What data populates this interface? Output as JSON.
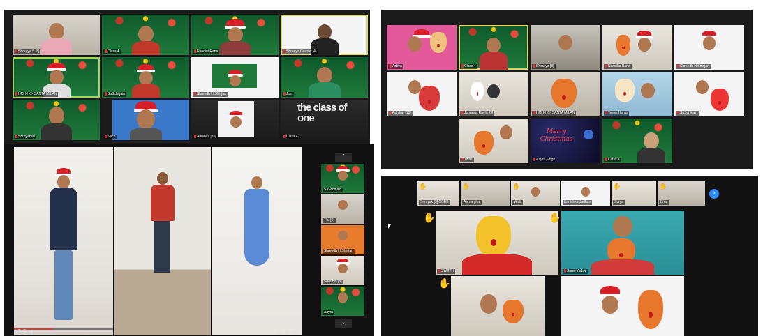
{
  "panel_a": {
    "tiles": [
      {
        "name": "Shourya S [8]"
      },
      {
        "name": "Class 4"
      },
      {
        "name": "Nandini Rana"
      },
      {
        "name": "Shreeya Gaurav [4]"
      },
      {
        "name": "HCH-HC- SANTA MILAN"
      },
      {
        "name": "SaSchitjain"
      },
      {
        "name": "Shreedh H Shinjan"
      },
      {
        "name": "Jnet"
      },
      {
        "name": "Shreyansh"
      },
      {
        "name": "Sach"
      },
      {
        "name": "Abhinav [10]"
      },
      {
        "name": "Class 4"
      }
    ],
    "logo_text": "the class of one"
  },
  "panel_b": {
    "strip": [
      {
        "name": "SaSchitjain"
      },
      {
        "name": "T'lu [0]"
      },
      {
        "name": "Shreedh H Shinjan"
      },
      {
        "name": "Shourya [8]"
      },
      {
        "name": "Aayra"
      }
    ],
    "arrows": {
      "up": "⌃",
      "down": "⌄"
    },
    "player": {
      "time": "00:00"
    }
  },
  "panel_c": {
    "tiles": [
      {
        "name": "Aditya"
      },
      {
        "name": "Class 4"
      },
      {
        "name": "Shourya [8]"
      },
      {
        "name": "Nandika Rana"
      },
      {
        "name": "Shreedh H Shinjan"
      },
      {
        "name": "Adhikar [10]"
      },
      {
        "name": "Johanna Ravlin [3]"
      },
      {
        "name": "HCH-HC- SANTA MILAN"
      },
      {
        "name": "Teesh Hunar"
      },
      {
        "name": "SaSchitjain"
      },
      {
        "name": "Tejas"
      },
      {
        "name": "Aayra Singh"
      },
      {
        "name": "Class 4"
      }
    ],
    "merry_text": "Merry Christmas"
  },
  "panel_d": {
    "strip": [
      {
        "name": "Samyak [3] COEB"
      },
      {
        "name": "Aarna ghai"
      },
      {
        "name": "Vedit"
      },
      {
        "name": "Kanishka Jadhav"
      },
      {
        "name": "Surya"
      },
      {
        "name": "Bhai"
      }
    ],
    "tiles": [
      {
        "name": "SWETH"
      },
      {
        "name": "Sanvi Yadav"
      },
      {
        "name": ""
      },
      {
        "name": ""
      }
    ],
    "next_arrow": "›"
  },
  "colors": {
    "panel_bg": "#1a1a1a",
    "highlight": "#d9d96a",
    "accent_blue": "#2d8cff",
    "santa_red": "#d61f26"
  }
}
